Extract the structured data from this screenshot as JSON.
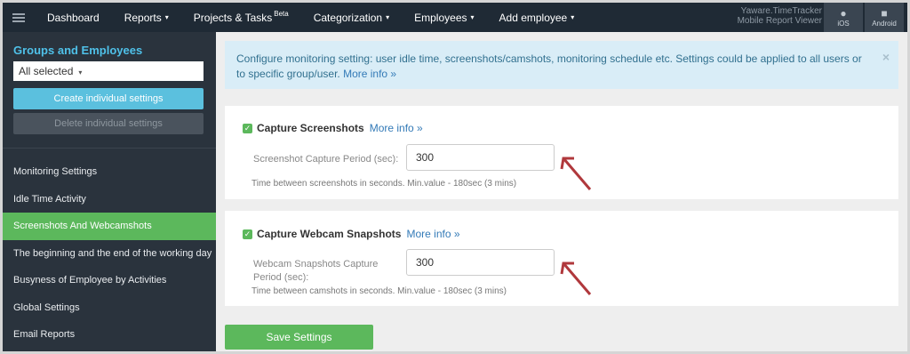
{
  "nav": {
    "items": [
      {
        "label": "Dashboard",
        "caret": false
      },
      {
        "label": "Reports",
        "caret": true
      },
      {
        "label": "Projects & Tasks",
        "sup": "Beta",
        "caret": false
      },
      {
        "label": "Categorization",
        "caret": true
      },
      {
        "label": "Employees",
        "caret": true
      },
      {
        "label": "Add employee",
        "caret": true
      }
    ],
    "viewer_line1": "Yaware.TimeTracker",
    "viewer_line2": "Mobile Report Viewer",
    "ios_label": "iOS",
    "android_label": "Android"
  },
  "sidebar": {
    "title": "Groups and Employees",
    "select_value": "All selected",
    "create_label": "Create individual settings",
    "delete_label": "Delete individual settings",
    "menu": [
      {
        "label": "Monitoring Settings",
        "active": false
      },
      {
        "label": "Idle Time Activity",
        "active": false
      },
      {
        "label": "Screenshots And Webcamshots",
        "active": true
      },
      {
        "label": "The beginning and the end of the working day",
        "active": false
      },
      {
        "label": "Busyness of Employee by Activities",
        "active": false
      },
      {
        "label": "Global Settings",
        "active": false
      },
      {
        "label": "Email Reports",
        "active": false
      }
    ]
  },
  "alert": {
    "text": "Configure monitoring setting: user idle time, screenshots/camshots, monitoring schedule etc. Settings could be applied to all users or to specific group/user.",
    "link": "More info »",
    "close": "×"
  },
  "screenshots": {
    "title": "Capture Screenshots",
    "more": "More info »",
    "label": "Screenshot Capture Period (sec):",
    "value": "300",
    "hint": "Time between screenshots in seconds. Min.value - 180sec (3 mins)"
  },
  "webcam": {
    "title": "Capture Webcam Snapshots",
    "more": "More info »",
    "label": "Webcam Snapshots Capture Period (sec):",
    "value": "300",
    "hint": "Time between camshots in seconds. Min.value - 180sec (3 mins)"
  },
  "save_label": "Save Settings",
  "colors": {
    "nav_bg": "#1f2a35",
    "sidebar_bg": "#2a333d",
    "accent_blue": "#4fc1e9",
    "green": "#5cb85c",
    "alert_bg": "#d9edf7",
    "arrow": "#b0383c"
  }
}
